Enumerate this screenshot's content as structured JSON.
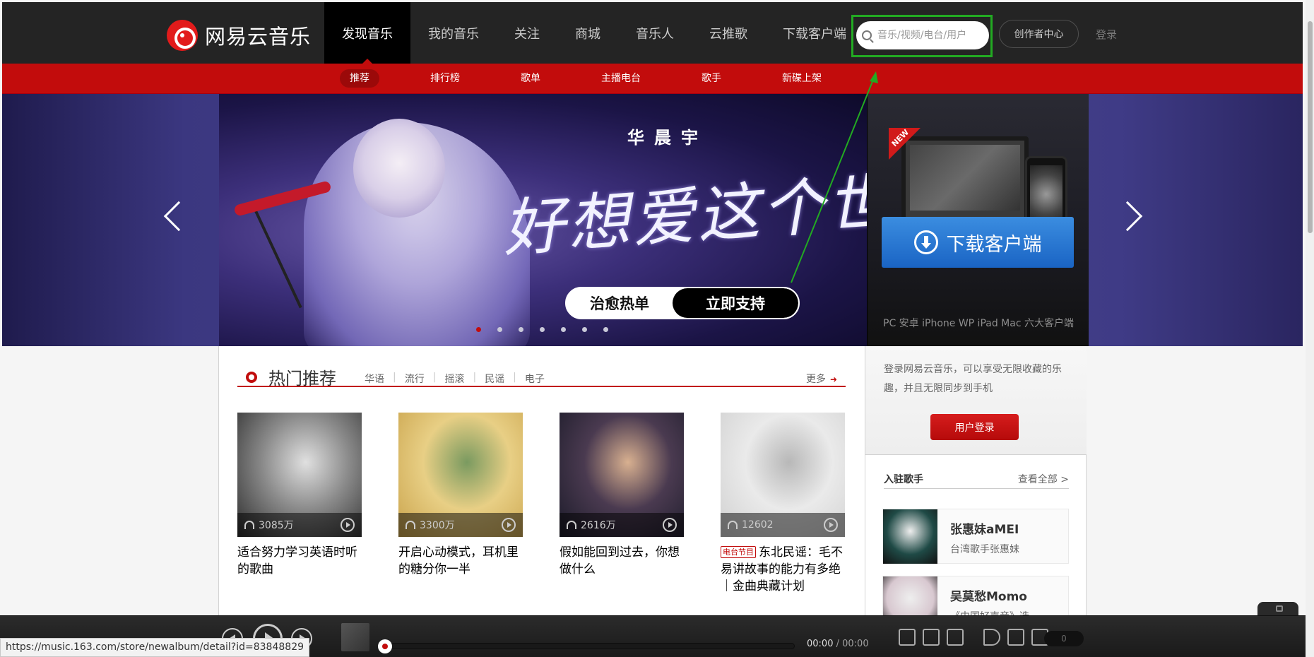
{
  "header": {
    "logo_text": "网易云音乐",
    "nav": [
      {
        "label": "发现音乐",
        "active": true
      },
      {
        "label": "我的音乐",
        "active": false
      },
      {
        "label": "关注",
        "active": false
      },
      {
        "label": "商城",
        "active": false
      },
      {
        "label": "音乐人",
        "active": false
      },
      {
        "label": "云推歌",
        "active": false
      },
      {
        "label": "下载客户端",
        "active": false
      }
    ],
    "search_placeholder": "音乐/视频/电台/用户",
    "creator_center": "创作者中心",
    "login": "登录"
  },
  "subnav": [
    {
      "label": "推荐",
      "active": true
    },
    {
      "label": "排行榜",
      "active": false
    },
    {
      "label": "歌单",
      "active": false
    },
    {
      "label": "主播电台",
      "active": false
    },
    {
      "label": "歌手",
      "active": false
    },
    {
      "label": "新碟上架",
      "active": false
    }
  ],
  "banner": {
    "artist": "华晨宇",
    "slogan": "好想爱这个世界啊",
    "cta_left": "治愈热单",
    "cta_right": "立即支持",
    "dot_count": 7,
    "active_dot": 0,
    "new_badge": "NEW",
    "download_button": "下载客户端",
    "download_sub": "PC 安卓 iPhone WP iPad Mac 六大客户端"
  },
  "hot": {
    "title": "热门推荐",
    "tags": [
      "华语",
      "流行",
      "摇滚",
      "民谣",
      "电子"
    ],
    "more": "更多"
  },
  "playlists": [
    {
      "plays": "3085万",
      "title": "适合努力学习英语时听的歌曲",
      "badge": "",
      "colors": [
        "#2a2a2a",
        "#8a8a8a",
        "#e0e0e0"
      ]
    },
    {
      "plays": "3300万",
      "title": "开启心动模式，耳机里的糖分你一半",
      "badge": "",
      "colors": [
        "#c9a24a",
        "#e8cf85",
        "#7a9a60"
      ]
    },
    {
      "plays": "2616万",
      "title": "假如能回到过去，你想做什么",
      "badge": "",
      "colors": [
        "#1a1a28",
        "#4a3a50",
        "#d8b090"
      ]
    },
    {
      "plays": "12602",
      "title": "东北民谣：毛不易讲故事的能力有多绝｜金曲典藏计划",
      "badge": "电台节目",
      "colors": [
        "#d0d0d0",
        "#eaeaea",
        "#b8b8b8"
      ]
    }
  ],
  "sidebar": {
    "login_text": "登录网易云音乐，可以享受无限收藏的乐趣，并且无限同步到手机",
    "login_button": "用户登录",
    "singers_title": "入驻歌手",
    "singers_all": "查看全部 >",
    "singers": [
      {
        "name": "张惠妹aMEI",
        "desc": "台湾歌手张惠妹",
        "color": "#1f4a46"
      },
      {
        "name": "吴莫愁Momo",
        "desc": "《中国好声音》选",
        "color": "#d8c8d0"
      }
    ]
  },
  "player": {
    "time_current": "00:00",
    "time_separator": " / ",
    "time_total": "00:00",
    "playlist_count": "0"
  },
  "status_url": "https://music.163.com/store/newalbum/detail?id=83848829",
  "colors": {
    "brand_red": "#c20c0c",
    "nav_bg": "#242424",
    "highlight_box": "#22aa22"
  }
}
